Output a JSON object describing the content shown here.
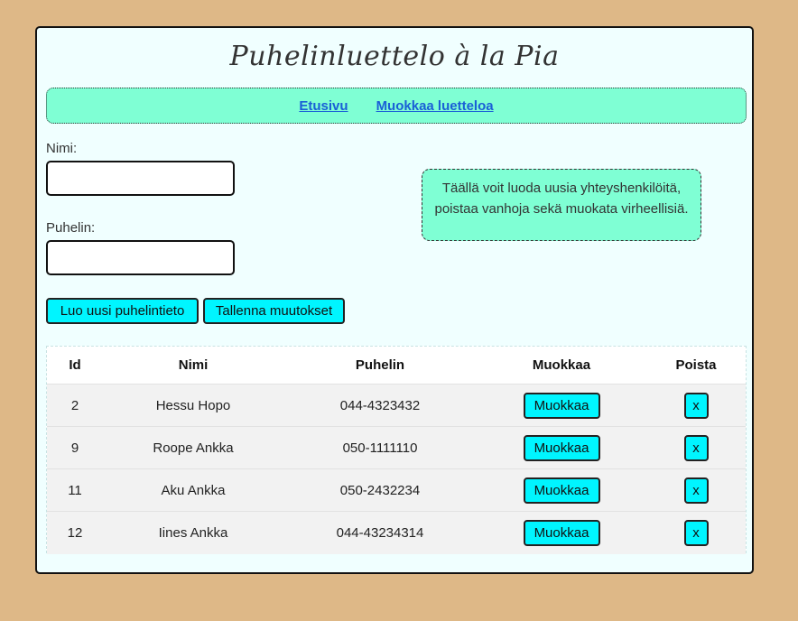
{
  "app": {
    "title": "Puhelinluettelo à la Pia"
  },
  "nav": {
    "items": [
      "Etusivu",
      "Muokkaa luetteloa"
    ]
  },
  "form": {
    "name_label": "Nimi:",
    "name_value": "",
    "phone_label": "Puhelin:",
    "phone_value": "",
    "create_button": "Luo uusi puhelintieto",
    "save_button": "Tallenna muutokset"
  },
  "info": {
    "line1": "Täällä voit luoda uusia yhteyshenkilöitä,",
    "line2": "poistaa vanhoja sekä muokata virheellisiä."
  },
  "table": {
    "headers": {
      "id": "Id",
      "name": "Nimi",
      "phone": "Puhelin",
      "edit": "Muokkaa",
      "delete": "Poista"
    },
    "rows": [
      {
        "id": "2",
        "name": "Hessu Hopo",
        "phone": "044-4323432",
        "edit": "Muokkaa",
        "delete": "x"
      },
      {
        "id": "9",
        "name": "Roope Ankka",
        "phone": "050-1111110",
        "edit": "Muokkaa",
        "delete": "x"
      },
      {
        "id": "11",
        "name": "Aku Ankka",
        "phone": "050-2432234",
        "edit": "Muokkaa",
        "delete": "x"
      },
      {
        "id": "12",
        "name": "Iines Ankka",
        "phone": "044-43234314",
        "edit": "Muokkaa",
        "delete": "x"
      }
    ]
  },
  "colors": {
    "background": "#deb887",
    "card": "#f0ffff",
    "accent": "#7fffd4",
    "button": "#00f5ff",
    "link": "#1a5fd6"
  }
}
